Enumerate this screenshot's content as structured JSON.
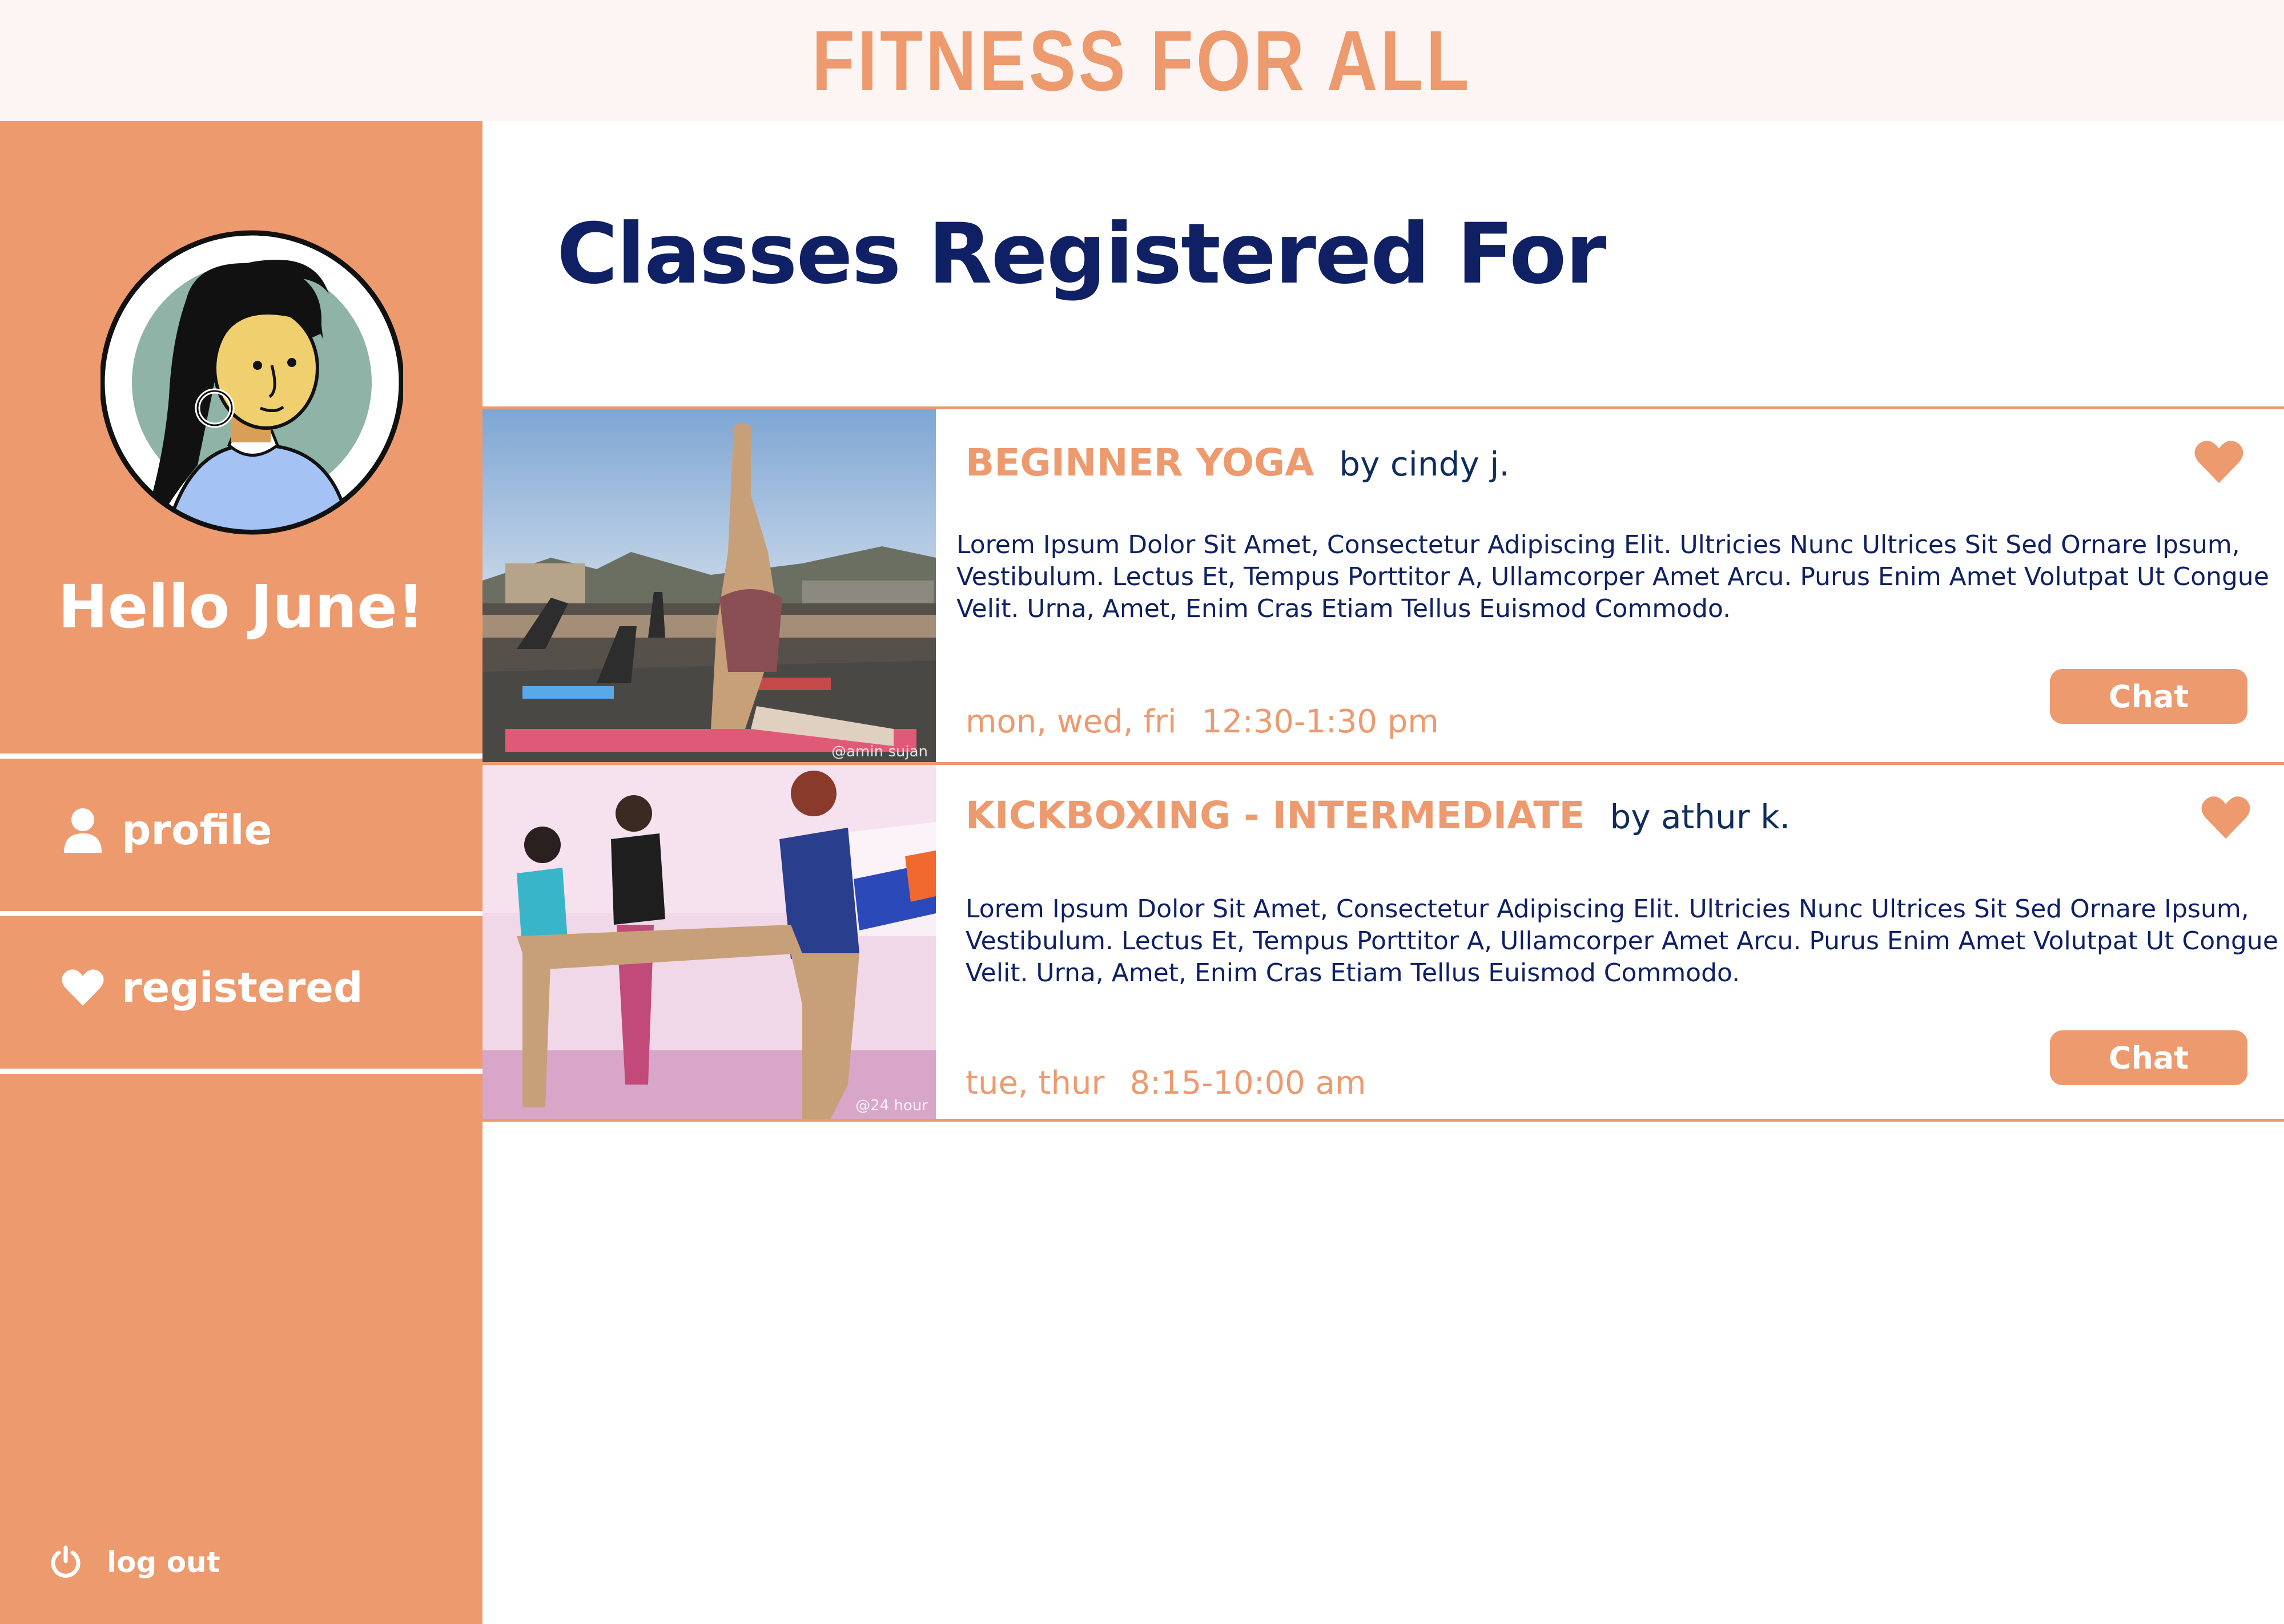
{
  "header": {
    "title": "FITNESS FOR ALL"
  },
  "sidebar": {
    "greeting": "Hello June!",
    "nav": [
      {
        "label": "profile",
        "icon": "user-icon"
      },
      {
        "label": "registered",
        "icon": "heart-icon"
      }
    ],
    "logout": {
      "label": "log out",
      "icon": "power-icon"
    }
  },
  "main": {
    "title": "Classes Registered For",
    "classes": [
      {
        "title": "BEGINNER YOGA",
        "instructor": "by cindy j.",
        "description": "Lorem Ipsum Dolor Sit Amet, Consectetur Adipiscing Elit. Ultricies Nunc Ultrices Sit Sed Ornare Ipsum, Vestibulum. Lectus Et, Tempus Porttitor A, Ullamcorper Amet Arcu. Purus Enim Amet Volutpat Ut Congue Velit. Urna, Amet, Enim Cras Etiam Tellus Euismod Commodo.",
        "days": "mon, wed, fri",
        "time": "12:30-1:30 pm",
        "chat_label": "Chat",
        "photo_credit": "@amin sujan",
        "favorited": true
      },
      {
        "title": "KICKBOXING - INTERMEDIATE",
        "instructor": "by athur k.",
        "description": "Lorem Ipsum Dolor Sit Amet, Consectetur Adipiscing Elit. Ultricies Nunc Ultrices Sit Sed Ornare Ipsum, Vestibulum. Lectus Et, Tempus Porttitor A, Ullamcorper Amet Arcu. Purus Enim Amet Volutpat Ut Congue Velit. Urna, Amet, Enim Cras Etiam Tellus Euismod Commodo.",
        "days": "tue, thur",
        "time": "8:15-10:00 am",
        "chat_label": "Chat",
        "photo_credit": "@24 hour",
        "favorited": true
      }
    ]
  },
  "colors": {
    "accent": "#ec9a6e",
    "navy": "#0f2064",
    "header_bg": "#fdf5f3"
  }
}
